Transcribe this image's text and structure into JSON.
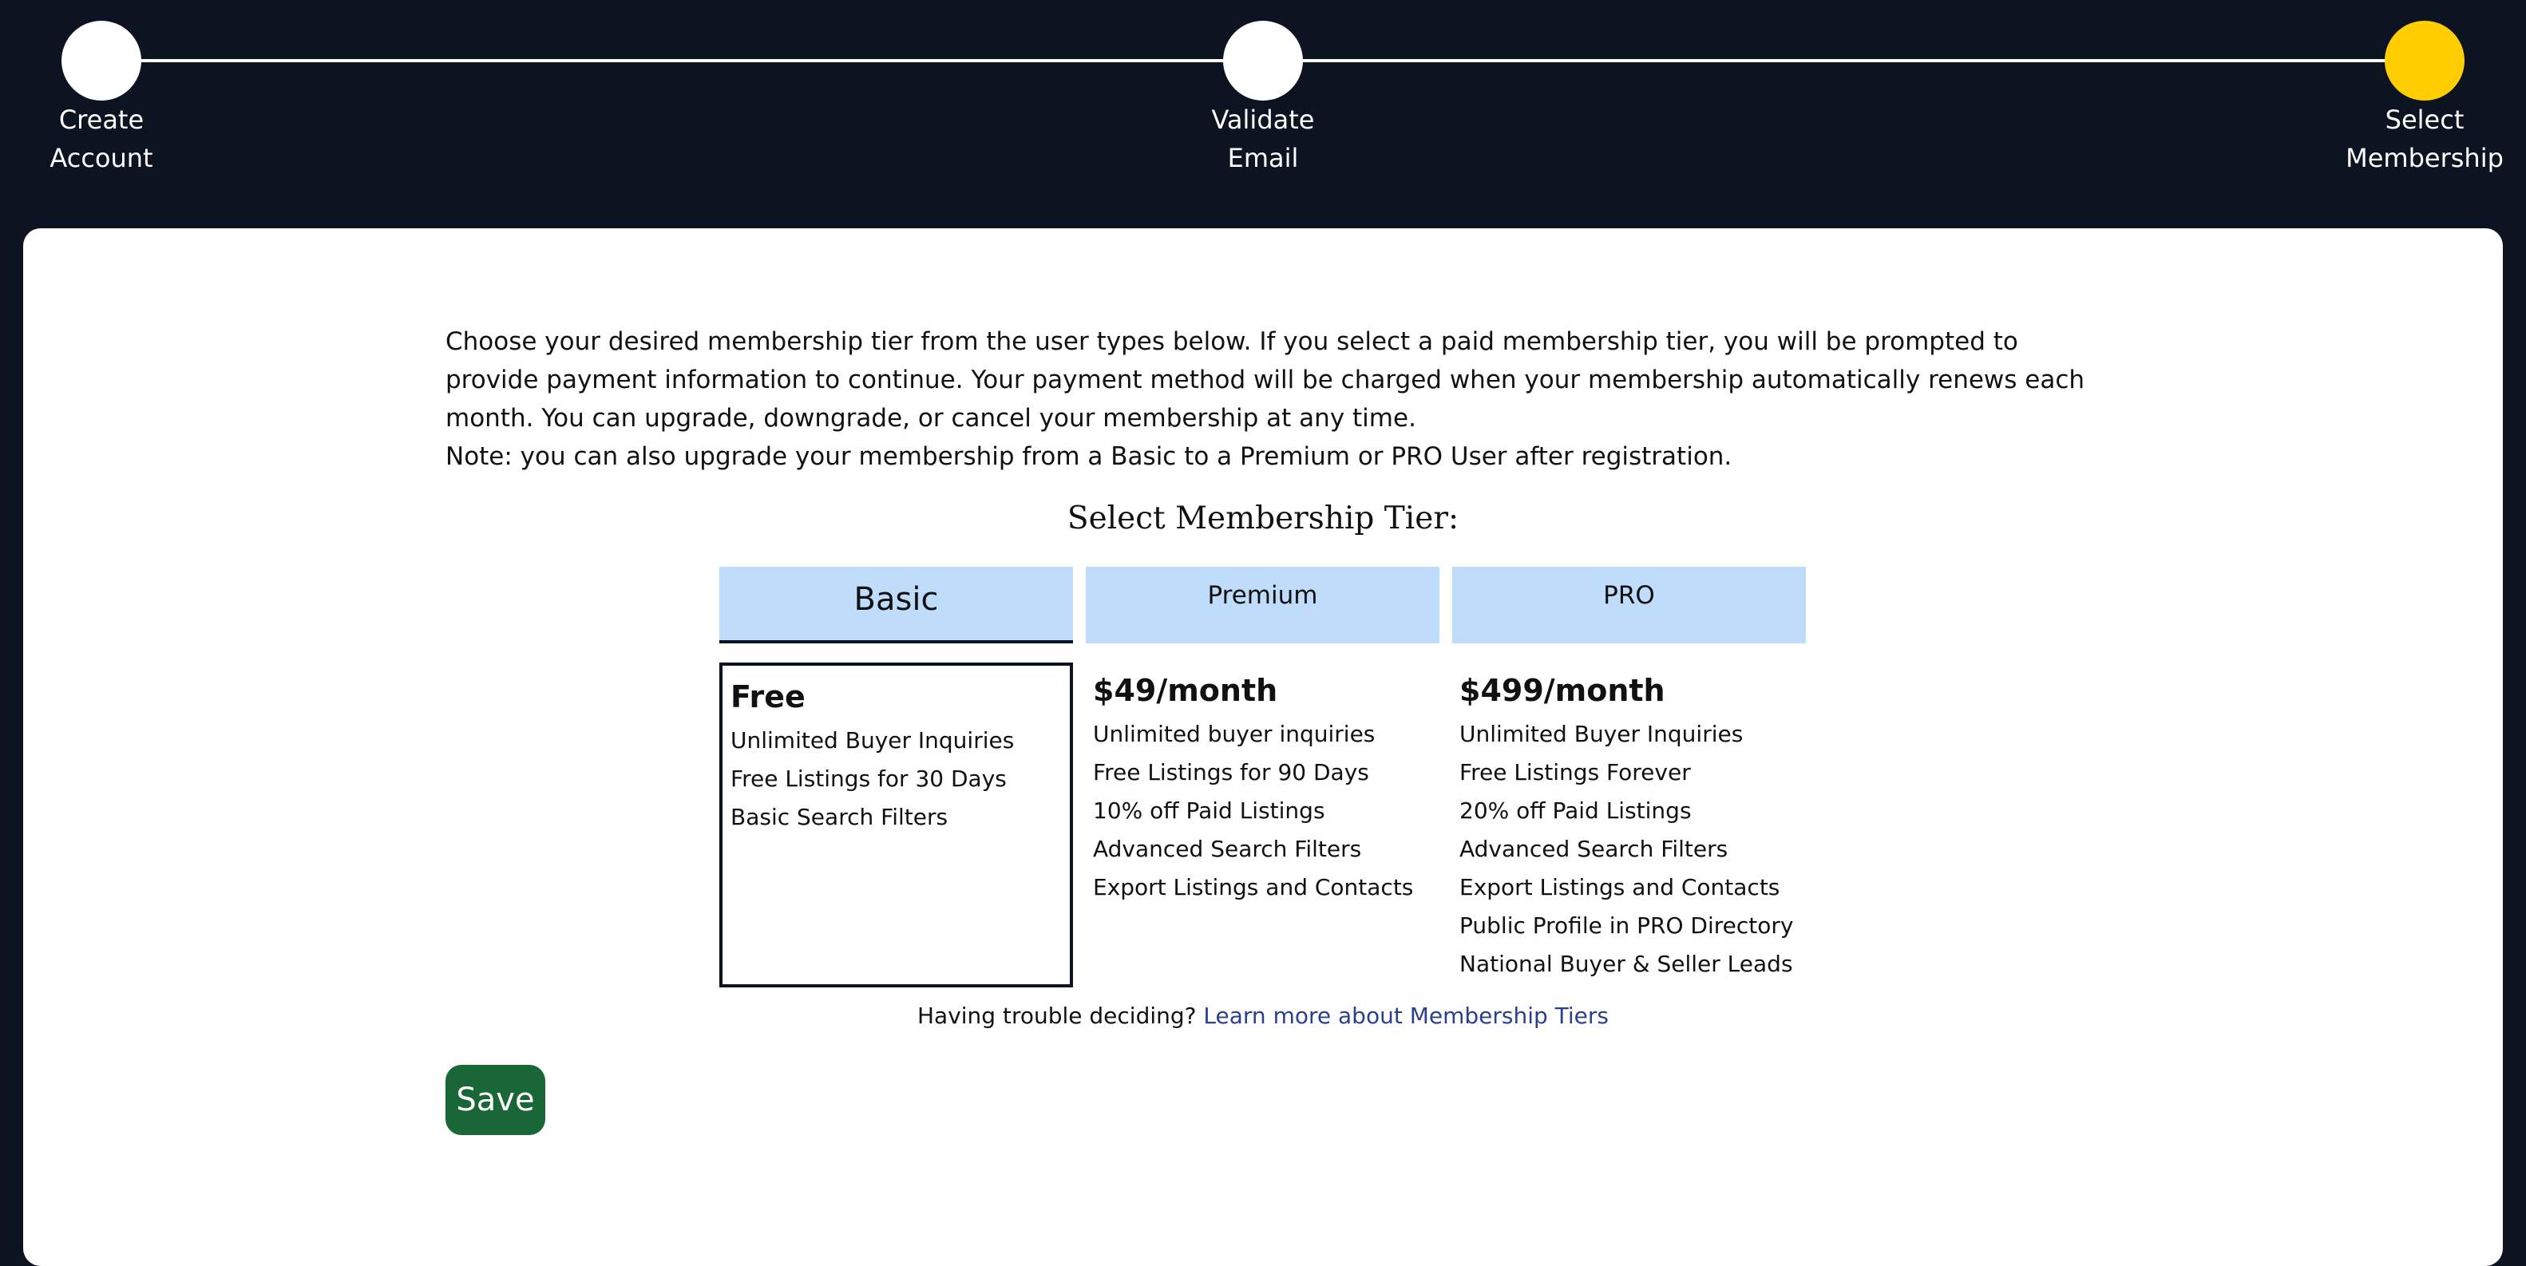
{
  "stepper": {
    "steps": [
      {
        "label_line1": "Create",
        "label_line2": "Account",
        "state": "complete"
      },
      {
        "label_line1": "Validate",
        "label_line2": "Email",
        "state": "complete"
      },
      {
        "label_line1": "Select",
        "label_line2": "Membership",
        "state": "current"
      }
    ],
    "active_color": "#ffcd00"
  },
  "intro": {
    "paragraph": "Choose your desired membership tier from the user types below. If you select a paid membership tier, you will be prompted to provide payment information to continue. Your payment method will be charged when your membership automatically renews each month. You can upgrade, downgrade, or cancel your membership at any time.",
    "note": "Note: you can also upgrade your membership from a Basic to a Premium or PRO User after registration."
  },
  "tiers": {
    "title": "Select Membership Tier:",
    "selected": "Basic",
    "items": [
      {
        "name": "Basic",
        "price": "Free",
        "features": [
          "Unlimited Buyer Inquiries",
          "Free Listings for 30 Days",
          "Basic Search Filters"
        ]
      },
      {
        "name": "Premium",
        "price": "$49/month",
        "features": [
          "Unlimited buyer inquiries",
          "Free Listings for 90 Days",
          "10% off Paid Listings",
          "Advanced Search Filters",
          "Export Listings and Contacts"
        ]
      },
      {
        "name": "PRO",
        "price": "$499/month",
        "features": [
          "Unlimited Buyer Inquiries",
          "Free Listings Forever",
          "20% off Paid Listings",
          "Advanced Search Filters",
          "Export Listings and Contacts",
          "Public Profile in PRO Directory",
          "National Buyer & Seller Leads"
        ]
      }
    ]
  },
  "help": {
    "prefix": "Having trouble deciding?",
    "link_label": "Learn more about Membership Tiers"
  },
  "actions": {
    "save_label": "Save",
    "save_color": "#196637"
  }
}
